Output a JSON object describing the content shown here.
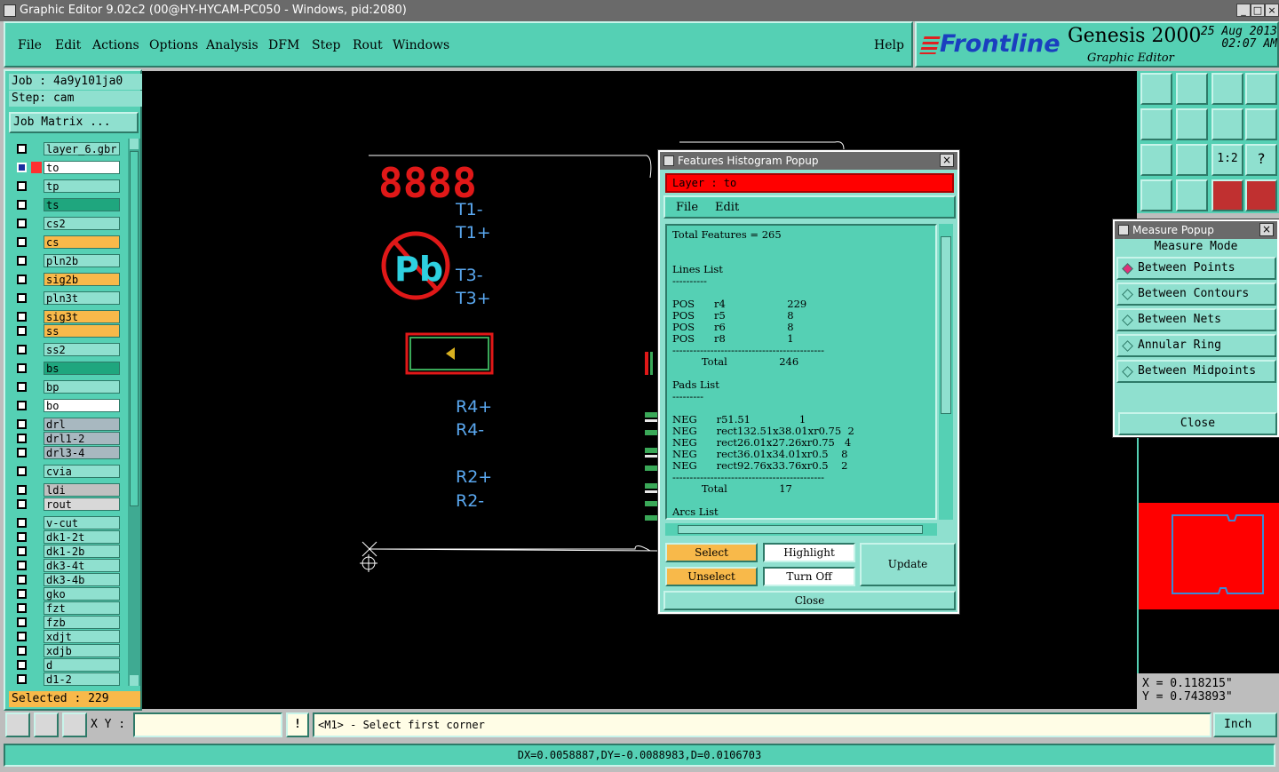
{
  "window": {
    "title": "Graphic Editor 9.02c2 (00@HY-HYCAM-PC050 - Windows, pid:2080)",
    "min": "_",
    "max": "□",
    "close": "×"
  },
  "menu": {
    "items": [
      "File",
      "Edit",
      "Actions",
      "Options",
      "Analysis",
      "DFM",
      "Step",
      "Rout",
      "Windows"
    ],
    "help": "Help"
  },
  "brand": {
    "logo": "Frontline",
    "product": "Genesis 2000",
    "subtitle": "Graphic Editor",
    "date": "25 Aug 2013",
    "time": "02:07 AM"
  },
  "left": {
    "job": "Job : 4a9y101ja0",
    "step": "Step: cam",
    "job_matrix": "Job Matrix ...",
    "selected": "Selected : 229",
    "layers": [
      {
        "name": "layer_6.gbr",
        "color": "#8fe0cf"
      },
      {
        "name": "to",
        "color": "#ffffff"
      },
      {
        "name": "tp",
        "color": "#8fe0cf"
      },
      {
        "name": "ts",
        "color": "#1fa67e"
      },
      {
        "name": "cs2",
        "color": "#8fe0cf"
      },
      {
        "name": "cs",
        "color": "#f8b94a"
      },
      {
        "name": "pln2b",
        "color": "#8fe0cf"
      },
      {
        "name": "sig2b",
        "color": "#f8b94a"
      },
      {
        "name": "pln3t",
        "color": "#8fe0cf"
      },
      {
        "name": "sig3t",
        "color": "#f8b94a"
      },
      {
        "name": "ss",
        "color": "#f8b94a"
      },
      {
        "name": "ss2",
        "color": "#8fe0cf"
      },
      {
        "name": "bs",
        "color": "#1fa67e"
      },
      {
        "name": "bp",
        "color": "#8fe0cf"
      },
      {
        "name": "bo",
        "color": "#ffffff"
      },
      {
        "name": "drl",
        "color": "#a8b8c0"
      },
      {
        "name": "drl1-2",
        "color": "#a8b8c0"
      },
      {
        "name": "drl3-4",
        "color": "#a8b8c0"
      },
      {
        "name": "cvia",
        "color": "#8fe0cf"
      },
      {
        "name": "ldi",
        "color": "#c0c0c0"
      },
      {
        "name": "rout",
        "color": "#d8d8d8"
      },
      {
        "name": "v-cut",
        "color": "#8fe0cf"
      },
      {
        "name": "dk1-2t",
        "color": "#8fe0cf"
      },
      {
        "name": "dk1-2b",
        "color": "#8fe0cf"
      },
      {
        "name": "dk3-4t",
        "color": "#8fe0cf"
      },
      {
        "name": "dk3-4b",
        "color": "#8fe0cf"
      },
      {
        "name": "gko",
        "color": "#8fe0cf"
      },
      {
        "name": "fzt",
        "color": "#8fe0cf"
      },
      {
        "name": "fzb",
        "color": "#8fe0cf"
      },
      {
        "name": "xdjt",
        "color": "#8fe0cf"
      },
      {
        "name": "xdjb",
        "color": "#8fe0cf"
      },
      {
        "name": "d",
        "color": "#8fe0cf"
      },
      {
        "name": "d1-2",
        "color": "#8fe0cf"
      }
    ]
  },
  "canvas": {
    "digits": "8888",
    "pb": "Pb",
    "labels": [
      "T1-",
      "T1+",
      "T3-",
      "T3+",
      "R4+",
      "R4-",
      "R2+",
      "R2-"
    ]
  },
  "histogram": {
    "title": "Features Histogram Popup",
    "layer": "Layer :  to",
    "menu": [
      "File",
      "Edit"
    ],
    "lines": [
      "Total Features = 265",
      "",
      "",
      "Lines List",
      "----------",
      "",
      "POS      r4                   229",
      "POS      r5                   8",
      "POS      r6                   8",
      "POS      r8                   1",
      "--------------------------------------------",
      "         Total                246",
      "",
      "Pads List",
      "---------",
      "",
      "NEG      r51.51               1",
      "NEG      rect132.51x38.01xr0.75  2",
      "NEG      rect26.01x27.26xr0.75   4",
      "NEG      rect36.01x34.01xr0.5    8",
      "NEG      rect92.76x33.76xr0.5    2",
      "--------------------------------------------",
      "         Total                17",
      "",
      "Arcs List"
    ],
    "select": "Select",
    "unselect": "Unselect",
    "highlight": "Highlight",
    "turn_off": "Turn Off",
    "update": "Update",
    "close": "Close"
  },
  "measure": {
    "title": "Measure Popup",
    "mode": "Measure Mode",
    "options": [
      "Between Points",
      "Between Contours",
      "Between Nets",
      "Annular Ring",
      "Between Midpoints"
    ],
    "selected": 0,
    "close": "Close"
  },
  "coords": {
    "x": "X = 0.118215\"",
    "y": "Y = 0.743893\""
  },
  "cmd": {
    "xy_label": "X Y :",
    "xy_value": "",
    "bang": "!",
    "prompt": "<M1> - Select first corner",
    "units": "Inch"
  },
  "status": "DX=0.0058887,DY=-0.0088983,D=0.0106703",
  "colors": {
    "panel": "#55d0b4",
    "light": "#8fe0cf",
    "accent_red": "#ff0000",
    "orange": "#f8b94a"
  }
}
